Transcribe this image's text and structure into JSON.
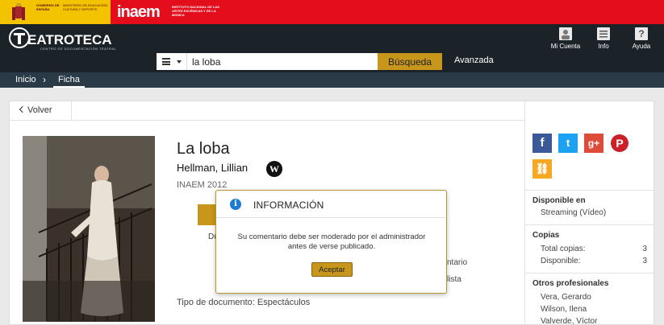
{
  "gov": {
    "ministry_line1": "GOBIERNO DE ESPAÑA",
    "ministry_line2": "MINISTERIO DE EDUCACIÓN, CULTURA Y DEPORTE",
    "inaem_logo": "inaem",
    "inaem_desc": "INSTITUTO NACIONAL DE LAS ARTES ESCÉNICAS Y DE LA MÚSICA"
  },
  "header": {
    "logo_text": "EATROTECA",
    "logo_sub": "CENTRO DE DOCUMENTACIÓN TEATRAL",
    "account_label": "Mi Cuenta",
    "info_label": "Info",
    "help_label": "Ayuda",
    "help_glyph": "?"
  },
  "search": {
    "value": "la loba",
    "button_label": "Búsqueda",
    "advanced_label": "Avanzada"
  },
  "breadcrumb": {
    "home": "Inicio",
    "separator": "›",
    "current": "Ficha"
  },
  "record": {
    "back_label": "Volver",
    "title": "La loba",
    "author": "Hellman, Lillian",
    "wiki_glyph": "W",
    "publisher_year": "INAEM 2012",
    "partial_du": "Du",
    "partial_comment": "ntario",
    "partial_list": "lista",
    "doc_type": "Tipo de documento: Espectáculos"
  },
  "sidebar": {
    "social": {
      "facebook": "f",
      "twitter": "t",
      "googleplus": "g+",
      "pinterest": "P",
      "link": "⛓"
    },
    "available_title": "Disponible en",
    "available_value": "Streaming (Vídeo)",
    "copies_title": "Copias",
    "total_label": "Total copias:",
    "total_value": "3",
    "available_label": "Disponible:",
    "available_count": "3",
    "others_title": "Otros profesionales",
    "others": [
      "Vera, Gerardo",
      "Wilson, Ilena",
      "Valverde, Víctor"
    ]
  },
  "modal": {
    "title": "INFORMACIÓN",
    "message": "Su comentario debe ser moderado por el administrador antes de verse publicado.",
    "accept_label": "Aceptar"
  },
  "colors": {
    "gov_red": "#e30d1c",
    "gov_yellow": "#f3c200",
    "header_dark": "#1b2329",
    "accent_gold": "#c8961b",
    "info_blue": "#1d7bd6"
  }
}
